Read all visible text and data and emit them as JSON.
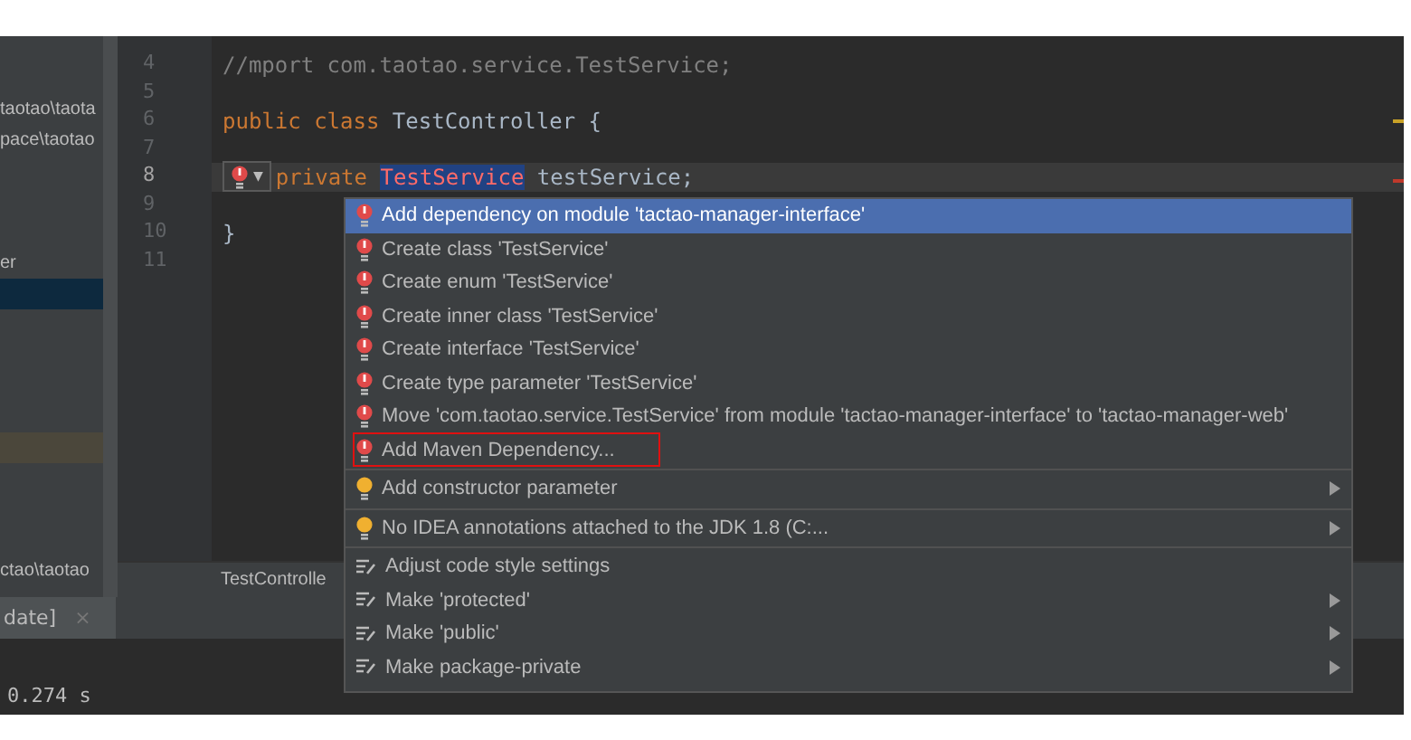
{
  "project_tree": {
    "rows": [
      {
        "kind": "text",
        "text": "taotao\\taota"
      },
      {
        "kind": "text",
        "text": "pace\\taotao"
      },
      {
        "kind": "gap"
      },
      {
        "kind": "gap"
      },
      {
        "kind": "gap"
      },
      {
        "kind": "text",
        "text": "er"
      },
      {
        "kind": "selected"
      },
      {
        "kind": "gap"
      },
      {
        "kind": "gap"
      },
      {
        "kind": "gap"
      },
      {
        "kind": "gap"
      },
      {
        "kind": "changed"
      },
      {
        "kind": "gap"
      },
      {
        "kind": "gap"
      },
      {
        "kind": "gap"
      },
      {
        "kind": "text",
        "text": "ctao\\taotao"
      }
    ]
  },
  "editor": {
    "lines": [
      {
        "number": "4",
        "current": false,
        "tokens": [
          {
            "kind": "comment",
            "text": "//mport com.taotao.service.TestService;"
          }
        ]
      },
      {
        "number": "5",
        "current": false
      },
      {
        "number": "6",
        "current": false,
        "tokens": [
          {
            "kind": "keyword",
            "text": "public class "
          },
          {
            "kind": "plain",
            "text": "TestController {"
          }
        ]
      },
      {
        "number": "7",
        "current": false
      },
      {
        "number": "8",
        "current": true,
        "tokens": [
          {
            "kind": "bulb",
            "text": "▼"
          },
          {
            "kind": "keyword",
            "text": "private "
          },
          {
            "kind": "error",
            "text": "TestService"
          },
          {
            "kind": "plain",
            "text": " testService;"
          }
        ]
      },
      {
        "number": "9",
        "current": false
      },
      {
        "number": "10",
        "current": false,
        "tokens": [
          {
            "kind": "plain",
            "text": "}"
          }
        ]
      },
      {
        "number": "11",
        "current": false
      }
    ],
    "file_tab": "TestControlle"
  },
  "intention_menu": {
    "items": [
      {
        "kind": "error",
        "text": "Add dependency on module 'tactao-manager-interface'",
        "selected": true,
        "submenu": false,
        "annotated": false
      },
      {
        "kind": "error",
        "text": "Create class 'TestService'",
        "selected": false,
        "submenu": false,
        "annotated": false
      },
      {
        "kind": "error",
        "text": "Create enum 'TestService'",
        "selected": false,
        "submenu": false,
        "annotated": false
      },
      {
        "kind": "error",
        "text": "Create inner class 'TestService'",
        "selected": false,
        "submenu": false,
        "annotated": false
      },
      {
        "kind": "error",
        "text": "Create interface 'TestService'",
        "selected": false,
        "submenu": false,
        "annotated": false
      },
      {
        "kind": "error",
        "text": "Create type parameter 'TestService'",
        "selected": false,
        "submenu": false,
        "annotated": false
      },
      {
        "kind": "error",
        "text": "Move 'com.taotao.service.TestService' from module 'tactao-manager-interface' to 'tactao-manager-web'",
        "selected": false,
        "submenu": false,
        "annotated": false
      },
      {
        "kind": "error",
        "text": "Add Maven Dependency...",
        "selected": false,
        "submenu": false,
        "annotated": true
      },
      {
        "kind": "separator"
      },
      {
        "kind": "intention",
        "text": "Add constructor parameter",
        "selected": false,
        "submenu": true,
        "annotated": false
      },
      {
        "kind": "separator"
      },
      {
        "kind": "intention",
        "text": "No IDEA annotations attached to the JDK 1.8 (C:...",
        "selected": false,
        "submenu": true,
        "annotated": false
      },
      {
        "kind": "separator"
      },
      {
        "kind": "style",
        "text": "Adjust code style settings",
        "selected": false,
        "submenu": false,
        "annotated": false
      },
      {
        "kind": "style",
        "text": "Make 'protected'",
        "selected": false,
        "submenu": true,
        "annotated": false
      },
      {
        "kind": "style",
        "text": "Make 'public'",
        "selected": false,
        "submenu": true,
        "annotated": false
      },
      {
        "kind": "style",
        "text": "Make package-private",
        "selected": false,
        "submenu": true,
        "annotated": false
      }
    ]
  },
  "tool_window": {
    "tab": "date]",
    "close": "×",
    "console_line": "0.274 s"
  }
}
